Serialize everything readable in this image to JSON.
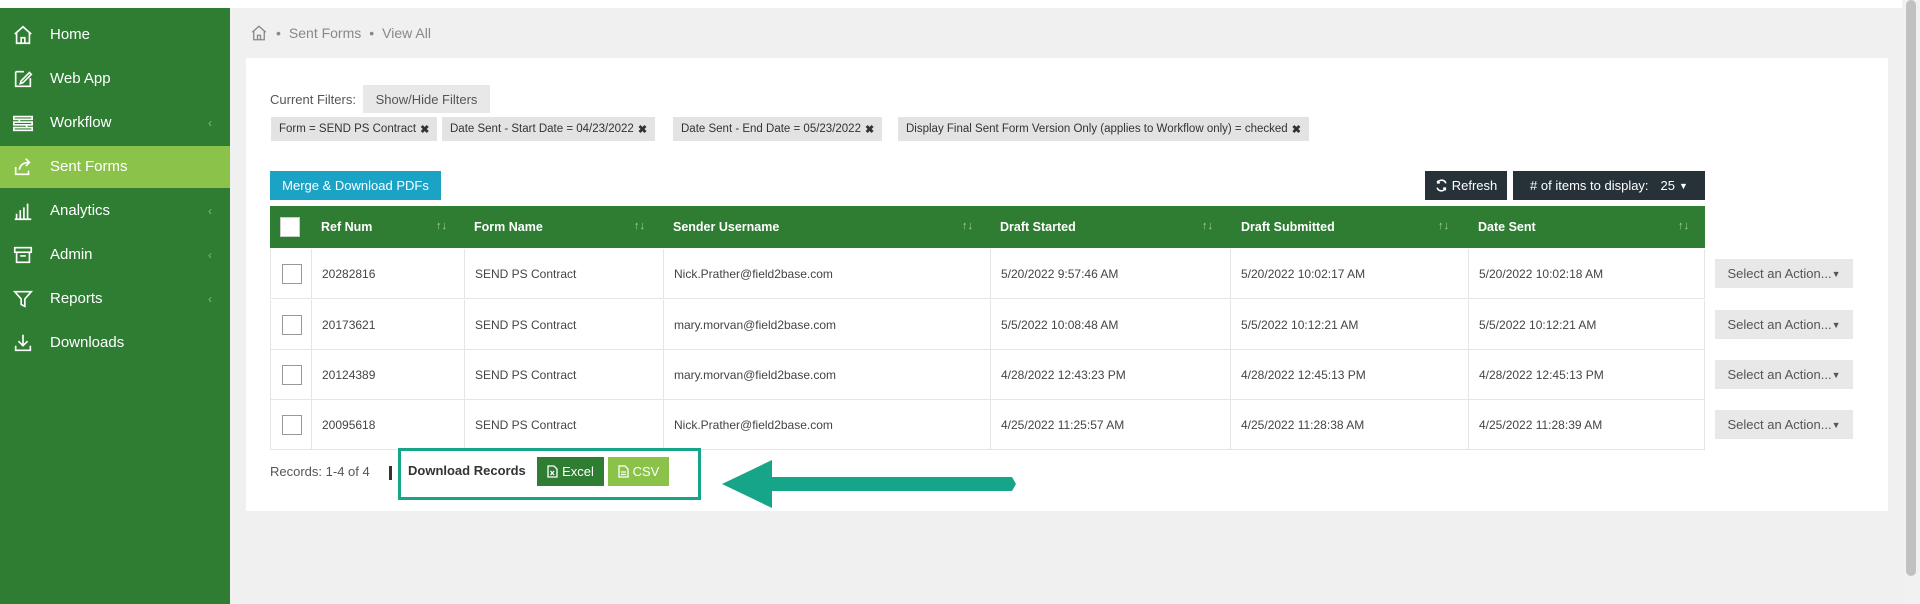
{
  "sidebar": {
    "items": [
      {
        "label": "Home",
        "icon": "home-icon",
        "has_chevron": false
      },
      {
        "label": "Web App",
        "icon": "edit-icon",
        "has_chevron": false
      },
      {
        "label": "Workflow",
        "icon": "workflow-icon",
        "has_chevron": true
      },
      {
        "label": "Sent Forms",
        "icon": "share-icon",
        "has_chevron": false,
        "active": true
      },
      {
        "label": "Analytics",
        "icon": "bar-chart-icon",
        "has_chevron": true
      },
      {
        "label": "Admin",
        "icon": "archive-icon",
        "has_chevron": true
      },
      {
        "label": "Reports",
        "icon": "filter-icon",
        "has_chevron": true
      },
      {
        "label": "Downloads",
        "icon": "download-icon",
        "has_chevron": false
      }
    ],
    "chevron": "‹"
  },
  "breadcrumb": {
    "sep": "•",
    "items": [
      "Sent Forms",
      "View All"
    ]
  },
  "filters": {
    "label": "Current Filters:",
    "toggle_label": "Show/Hide Filters",
    "chips": [
      "Form = SEND PS Contract",
      "Date Sent - Start Date = 04/23/2022",
      "Date Sent - End Date = 05/23/2022",
      "Display Final Sent Form Version Only (applies to Workflow only) = checked"
    ],
    "remove_glyph": "✖"
  },
  "toolbar": {
    "merge_label": "Merge & Download PDFs",
    "refresh_label": "Refresh",
    "items_label": "# of items to display:",
    "items_value": "25"
  },
  "table": {
    "columns": [
      "Ref Num",
      "Form Name",
      "Sender Username",
      "Draft Started",
      "Draft Submitted",
      "Date Sent"
    ],
    "sort_glyph": "↑↓",
    "rows": [
      [
        "20282816",
        "SEND PS Contract",
        "Nick.Prather@field2base.com",
        "5/20/2022 9:57:46 AM",
        "5/20/2022 10:02:17 AM",
        "5/20/2022 10:02:18 AM"
      ],
      [
        "20173621",
        "SEND PS Contract",
        "mary.morvan@field2base.com",
        "5/5/2022 10:08:48 AM",
        "5/5/2022 10:12:21 AM",
        "5/5/2022 10:12:21 AM"
      ],
      [
        "20124389",
        "SEND PS Contract",
        "mary.morvan@field2base.com",
        "4/28/2022 12:43:23 PM",
        "4/28/2022 12:45:13 PM",
        "4/28/2022 12:45:13 PM"
      ],
      [
        "20095618",
        "SEND PS Contract",
        "Nick.Prather@field2base.com",
        "4/25/2022 11:25:57 AM",
        "4/25/2022 11:28:38 AM",
        "4/25/2022 11:28:39 AM"
      ]
    ],
    "action_label": "Select an Action..."
  },
  "footer": {
    "records_label": "Records:",
    "records_value": "1-4 of 4",
    "download_label": "Download Records",
    "excel_label": "Excel",
    "csv_label": "CSV"
  },
  "colors": {
    "sidebar": "#2e7d32",
    "active": "#8bc34a",
    "accent": "#1ba3c6",
    "highlight": "#17a589",
    "dark": "#263238"
  }
}
